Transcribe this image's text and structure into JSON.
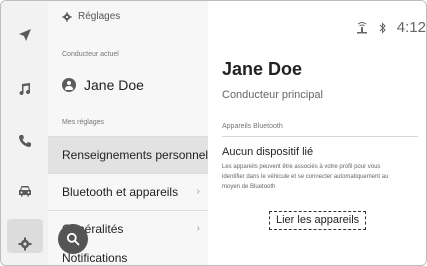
{
  "nav": {
    "items": [
      {
        "icon": "navigation-arrow-icon"
      },
      {
        "icon": "music-note-icon"
      },
      {
        "icon": "phone-icon"
      },
      {
        "icon": "car-icon"
      },
      {
        "icon": "gear-icon"
      }
    ]
  },
  "settings": {
    "title": "Réglages",
    "current_driver_label": "Conducteur actuel",
    "current_driver_name": "Jane Doe",
    "my_settings_label": "Mes réglages",
    "items": [
      {
        "label": "Renseignements personnels"
      },
      {
        "label": "Bluetooth et appareils"
      },
      {
        "label": "Généralités"
      },
      {
        "label": "Notifications"
      }
    ]
  },
  "status": {
    "time": "4:12"
  },
  "detail": {
    "name": "Jane Doe",
    "role": "Conducteur principal",
    "section": "Appareils Bluetooth",
    "no_device_title": "Aucun dispositif lié",
    "no_device_desc": "Les appareils peuvent être associés à votre profil pour vous identifier dans le véhicule et se connecter automatiquement au moyen de Bluetooth",
    "link_button": "Lier les appareils"
  }
}
